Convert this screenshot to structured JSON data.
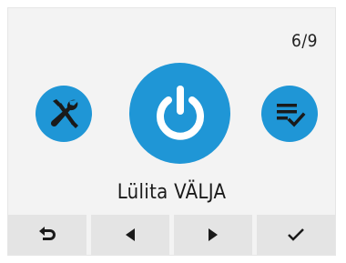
{
  "page_indicator": "6/9",
  "action_label": "Lülita VÄLJA",
  "colors": {
    "accent": "#1f96d6",
    "background": "#f3f3f3",
    "nav_button": "#e4e4e4",
    "icon_dark": "#1a1a1a"
  },
  "icons": {
    "left": "tools-icon",
    "center": "power-icon",
    "right": "checklist-icon"
  },
  "nav": [
    {
      "icon": "back-arrow-icon"
    },
    {
      "icon": "arrow-left-icon"
    },
    {
      "icon": "arrow-right-icon"
    },
    {
      "icon": "checkmark-icon"
    }
  ]
}
